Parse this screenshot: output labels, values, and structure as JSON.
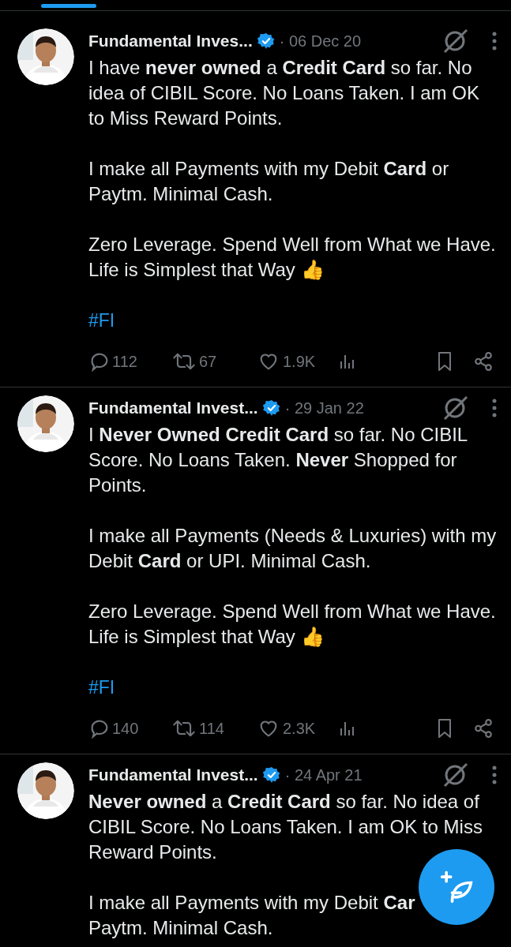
{
  "tweets": [
    {
      "author": "Fundamental Inves...",
      "verified": true,
      "date": "· 06 Dec 20",
      "paragraphs": [
        "I have **never owned** a **Credit Card** so far. No idea of CIBIL Score. No Loans Taken. I am OK to Miss Reward Points.",
        "I make all Payments with my Debit **Card** or Paytm. Minimal Cash.",
        "Zero Leverage. Spend Well from What we Have. Life is Simplest that Way 👍"
      ],
      "hashtag": "#FI",
      "stats": {
        "replies": "112",
        "reposts": "67",
        "likes": "1.9K"
      }
    },
    {
      "author": "Fundamental Invest...",
      "verified": true,
      "date": "· 29 Jan 22",
      "paragraphs": [
        "I **Never Owned Credit Card** so far. No CIBIL Score. No Loans Taken. **Never** Shopped for Points.",
        "I make all Payments (Needs & Luxuries) with my Debit **Card** or UPI. Minimal Cash.",
        "Zero Leverage. Spend Well from What we Have. Life is Simplest that Way 👍"
      ],
      "hashtag": "#FI",
      "stats": {
        "replies": "140",
        "reposts": "114",
        "likes": "2.3K"
      }
    },
    {
      "author": "Fundamental Invest...",
      "verified": true,
      "date": "· 24 Apr 21",
      "paragraphs": [
        "**Never owned** a **Credit Card** so far. No idea of CIBIL Score. No Loans Taken. I am OK to Miss Reward Points.",
        "I make all Payments with my Debit **Car**\nPaytm. Minimal Cash."
      ]
    }
  ]
}
